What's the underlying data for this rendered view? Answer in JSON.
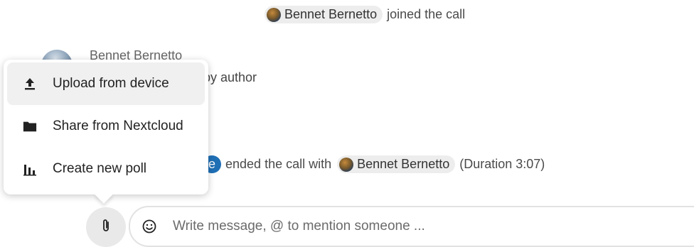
{
  "events": {
    "joined": {
      "user": "Bennet Bernetto",
      "text": "joined the call"
    },
    "ended": {
      "self_label": "e",
      "text": "ended the call with",
      "user": "Bennet Bernetto",
      "duration": "(Duration 3:07)"
    }
  },
  "message": {
    "author": "Bennet Bernetto",
    "text_fragment": "by author"
  },
  "attach_menu": {
    "items": [
      {
        "label": "Upload from device",
        "icon": "upload-icon"
      },
      {
        "label": "Share from Nextcloud",
        "icon": "folder-icon"
      },
      {
        "label": "Create new poll",
        "icon": "poll-icon"
      }
    ]
  },
  "composer": {
    "placeholder": "Write message, @ to mention someone ...",
    "emoji_icon": "emoji-icon",
    "attach_icon": "paperclip-icon"
  },
  "colors": {
    "accent": "#1f6fb5",
    "mention_bg": "#ededed"
  }
}
